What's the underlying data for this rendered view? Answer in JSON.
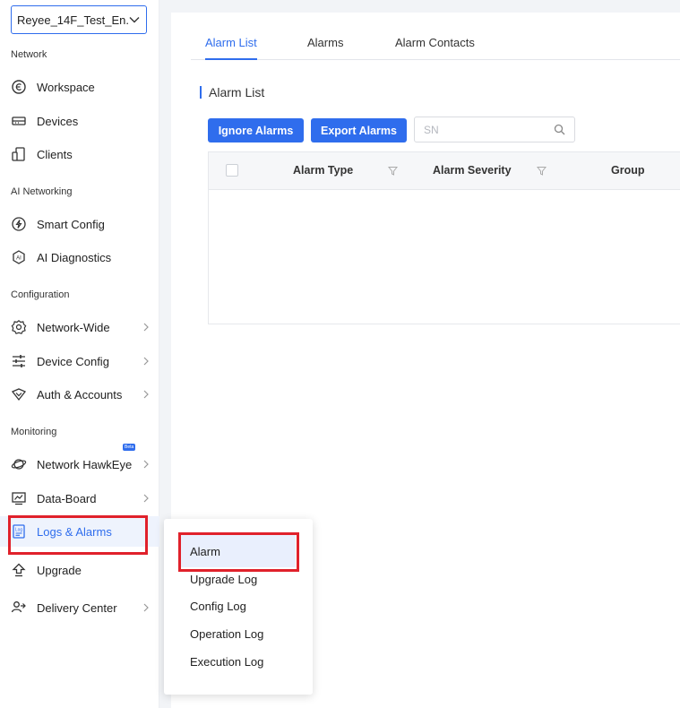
{
  "project": {
    "name": "Reyee_14F_Test_En..."
  },
  "sidebar": {
    "groups": {
      "network": "Network",
      "ai_networking": "AI Networking",
      "configuration": "Configuration",
      "monitoring": "Monitoring"
    },
    "items": {
      "workspace": "Workspace",
      "devices": "Devices",
      "clients": "Clients",
      "smart_config": "Smart Config",
      "ai_diagnostics": "AI Diagnostics",
      "network_wide": "Network-Wide",
      "device_config": "Device Config",
      "auth_accounts": "Auth & Accounts",
      "network_hawkeye": "Network HawkEye",
      "data_board": "Data-Board",
      "logs_alarms": "Logs & Alarms",
      "upgrade": "Upgrade",
      "delivery_center": "Delivery Center"
    },
    "beta_badge": "Beta"
  },
  "tabs": [
    "Alarm List",
    "Alarms",
    "Alarm Contacts"
  ],
  "section_title": "Alarm List",
  "toolbar": {
    "ignore_label": "Ignore Alarms",
    "export_label": "Export Alarms",
    "search_placeholder": "SN"
  },
  "table": {
    "columns": [
      "Alarm Type",
      "Alarm Severity",
      "Group"
    ]
  },
  "dropdown": {
    "items": [
      "Alarm",
      "Upgrade Log",
      "Config Log",
      "Operation Log",
      "Execution Log"
    ]
  },
  "colors": {
    "accent": "#2f6ded",
    "highlight": "#e0212b"
  }
}
